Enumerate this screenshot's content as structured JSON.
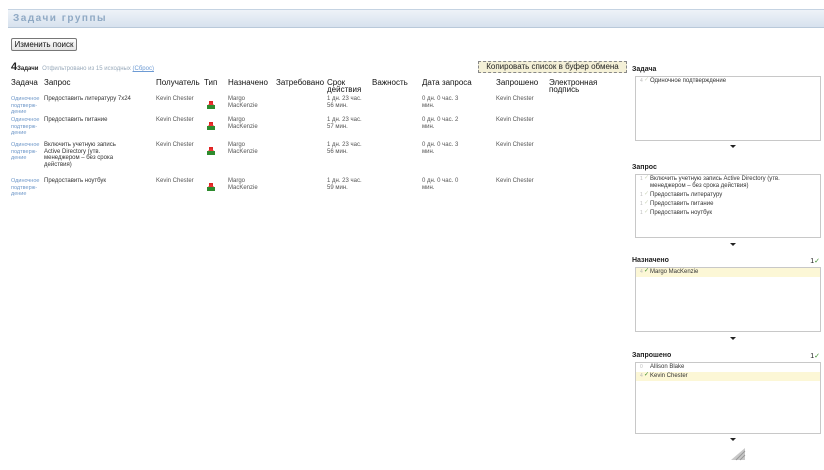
{
  "window": {
    "title": "Задачи группы"
  },
  "toolbar": {
    "change_search": "Изменить поиск",
    "copy_list": "Копировать список в буфер обмена"
  },
  "summary": {
    "count": "4",
    "count_label": "Задачи",
    "filter_text": "Отфильтровано из 15 исходных",
    "reset_link": "(Сброс)"
  },
  "table": {
    "headers": {
      "task": "Задача",
      "request": "Запрос",
      "recipient": "Получатель",
      "type": "Тип",
      "assigned": "Назначено",
      "claimed": "Затребовано",
      "due": "Срок действия",
      "priority": "Важность",
      "requested_date": "Дата запроса",
      "requested_by": "Запрошено",
      "signature": "Электронная подпись"
    },
    "rows": [
      {
        "task": "Одиночное подтверж- дение",
        "request": "Предоставить литературу 7x24",
        "recipient": "Kevin Chester",
        "assigned": "Margo MacKenzie",
        "due": "1 дн. 23 час. 56 мин.",
        "requested_date": "0 дн. 0 час. 3 мин.",
        "requested_by": "Kevin Chester"
      },
      {
        "task": "Одиночное подтверж- дение",
        "request": "Предоставить питание",
        "recipient": "Kevin Chester",
        "assigned": "Margo MacKenzie",
        "due": "1 дн. 23 час. 57 мин.",
        "requested_date": "0 дн. 0 час. 2 мин.",
        "requested_by": "Kevin Chester"
      },
      {
        "task": "Одиночное подтверж- дение",
        "request": "Включить учетную запись Active Directory (утв. менеджером – без срока действия)",
        "recipient": "Kevin Chester",
        "assigned": "Margo MacKenzie",
        "due": "1 дн. 23 час. 56 мин.",
        "requested_date": "0 дн. 0 час. 3 мин.",
        "requested_by": "Kevin Chester"
      },
      {
        "task": "Одиночное подтверж- дение",
        "request": "Предоставить ноутбук",
        "recipient": "Kevin Chester",
        "assigned": "Margo MacKenzie",
        "due": "1 дн. 23 час. 59 мин.",
        "requested_date": "0 дн. 0 час. 0 мин.",
        "requested_by": "Kevin Chester"
      }
    ]
  },
  "filters": {
    "task": {
      "title": "Задача",
      "items": [
        {
          "num": "4",
          "label": "Одиночное подтверждение",
          "selected": false
        }
      ]
    },
    "request": {
      "title": "Запрос",
      "items": [
        {
          "num": "1",
          "label": "Включить учетную запись Active Directory (утв. менеджером – без срока действия)",
          "selected": false
        },
        {
          "num": "1",
          "label": "Предоставить литературу",
          "selected": false
        },
        {
          "num": "1",
          "label": "Предоставить питание",
          "selected": false
        },
        {
          "num": "1",
          "label": "Предоставить ноутбук",
          "selected": false
        }
      ]
    },
    "assigned": {
      "title": "Назначено",
      "count": "1",
      "items": [
        {
          "num": "4",
          "label": "Margo MacKenzie",
          "selected": true
        }
      ]
    },
    "requested": {
      "title": "Запрошено",
      "count": "1",
      "items": [
        {
          "num": "0",
          "label": "Allison Blake",
          "selected": false
        },
        {
          "num": "4",
          "label": "Kevin Chester",
          "selected": true
        }
      ]
    }
  },
  "colors": {
    "link": "#6f98c9",
    "selected_bg": "#fcf7d6",
    "check": "#3a8a2a",
    "copy_bg": "#f4f0d7"
  }
}
